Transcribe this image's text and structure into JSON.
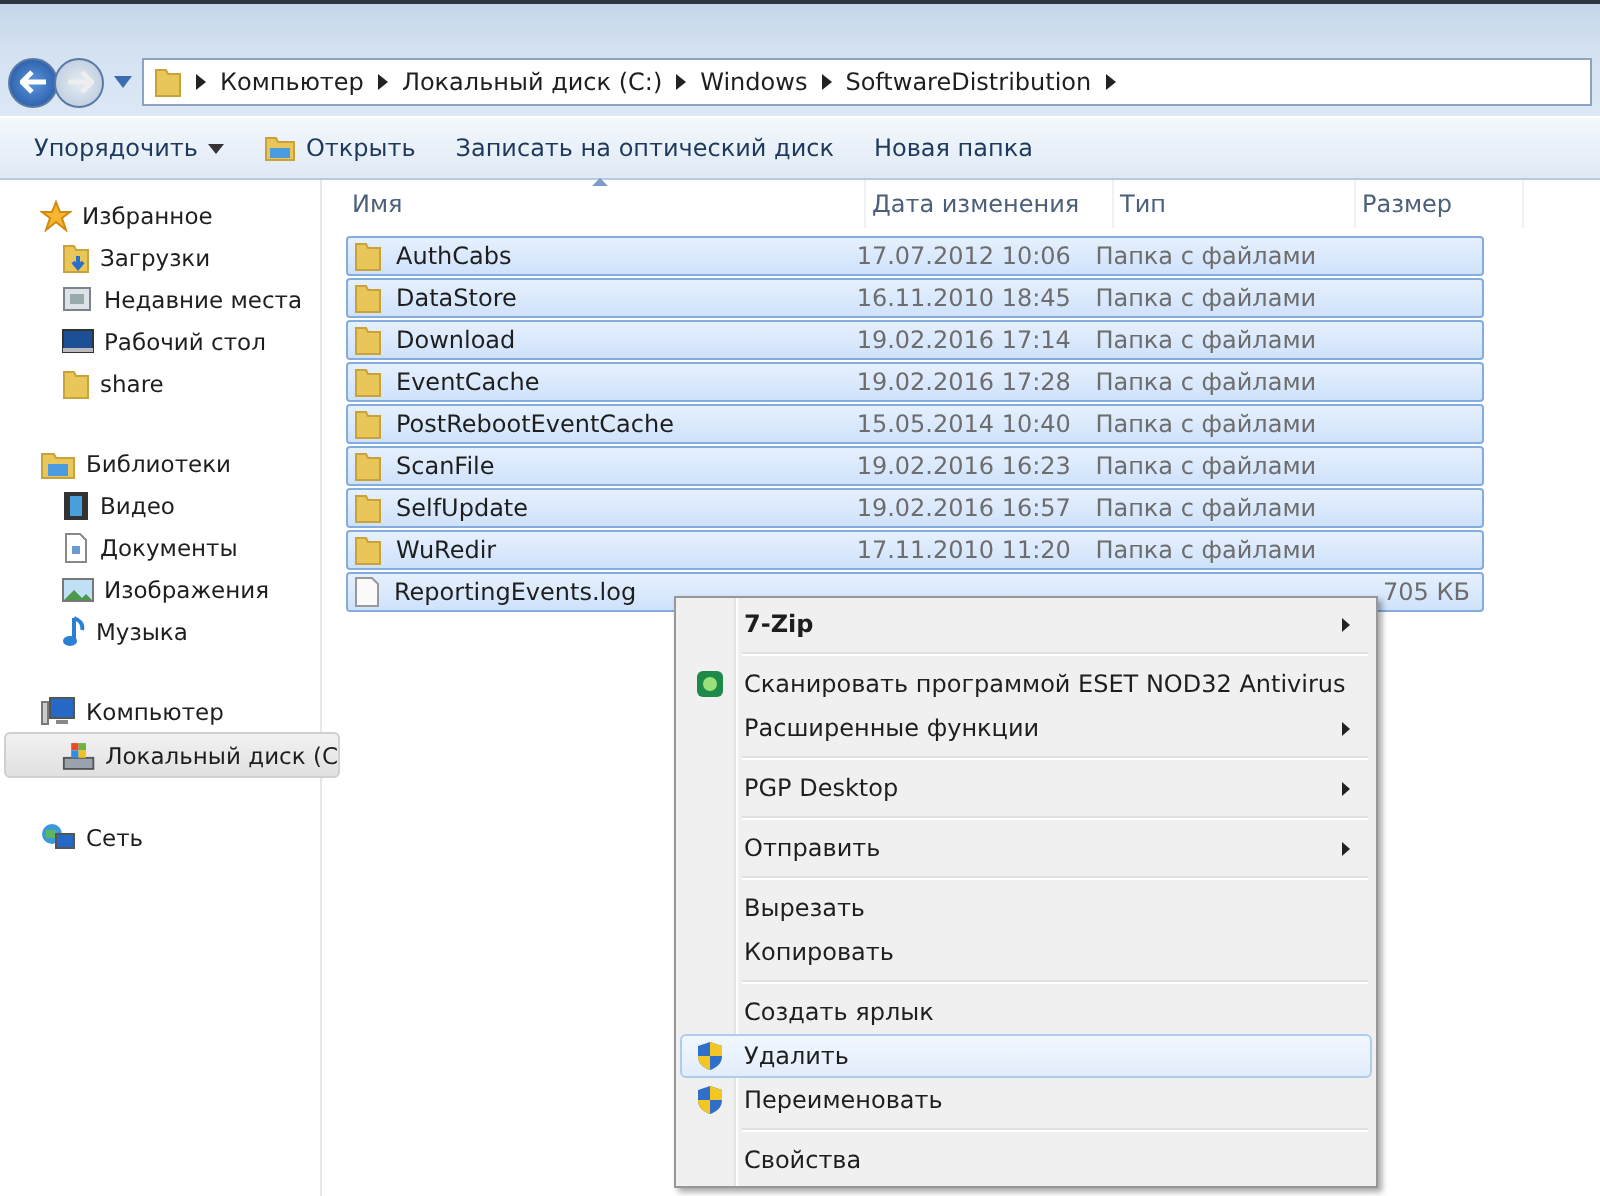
{
  "address_bar": {
    "crumbs": [
      "Компьютер",
      "Локальный диск (C:)",
      "Windows",
      "SoftwareDistribution"
    ]
  },
  "toolbar": {
    "items": [
      {
        "label": "Упорядочить",
        "kind": "dropdown"
      },
      {
        "label": "Открыть",
        "kind": "open"
      },
      {
        "label": "Записать на оптический диск",
        "kind": "plain"
      },
      {
        "label": "Новая папка",
        "kind": "plain"
      }
    ]
  },
  "sidebar": {
    "groups": [
      {
        "label": "Избранное",
        "kind": "star",
        "selected": false,
        "children": [
          {
            "label": "Загрузки",
            "kind": "download",
            "selected": false
          },
          {
            "label": "Недавние места",
            "kind": "recent",
            "selected": false
          },
          {
            "label": "Рабочий стол",
            "kind": "desktop",
            "selected": false
          },
          {
            "label": "share",
            "kind": "folder",
            "selected": false
          }
        ]
      },
      {
        "label": "Библиотеки",
        "kind": "library",
        "selected": false,
        "children": [
          {
            "label": "Видео",
            "kind": "video",
            "selected": false
          },
          {
            "label": "Документы",
            "kind": "documents",
            "selected": false
          },
          {
            "label": "Изображения",
            "kind": "pictures",
            "selected": false
          },
          {
            "label": "Музыка",
            "kind": "music",
            "selected": false
          }
        ]
      },
      {
        "label": "Компьютер",
        "kind": "computer",
        "selected": false,
        "children": [
          {
            "label": "Локальный диск (C",
            "kind": "drive",
            "selected": true
          }
        ]
      },
      {
        "label": "Сеть",
        "kind": "network",
        "selected": false
      }
    ]
  },
  "table": {
    "columns": [
      "Имя",
      "Дата изменения",
      "Тип",
      "Размер"
    ],
    "rows": [
      {
        "kind": "folder",
        "name": "AuthCabs",
        "date": "17.07.2012 10:06",
        "type": "Папка с файлами",
        "selected": true
      },
      {
        "kind": "folder",
        "name": "DataStore",
        "date": "16.11.2010 18:45",
        "type": "Папка с файлами",
        "selected": true
      },
      {
        "kind": "folder",
        "name": "Download",
        "date": "19.02.2016 17:14",
        "type": "Папка с файлами",
        "selected": true
      },
      {
        "kind": "folder",
        "name": "EventCache",
        "date": "19.02.2016 17:28",
        "type": "Папка с файлами",
        "selected": true
      },
      {
        "kind": "folder",
        "name": "PostRebootEventCache",
        "date": "15.05.2014 10:40",
        "type": "Папка с файлами",
        "selected": true
      },
      {
        "kind": "folder",
        "name": "ScanFile",
        "date": "19.02.2016 16:23",
        "type": "Папка с файлами",
        "selected": true
      },
      {
        "kind": "folder",
        "name": "SelfUpdate",
        "date": "19.02.2016 16:57",
        "type": "Папка с файлами",
        "selected": true
      },
      {
        "kind": "folder",
        "name": "WuRedir",
        "date": "17.11.2010 11:20",
        "type": "Папка с файлами",
        "selected": true
      },
      {
        "kind": "file",
        "name": "ReportingEvents.log",
        "size": "705 КБ",
        "selected": true
      }
    ]
  },
  "context_menu": {
    "groups": [
      [
        {
          "label": "7-Zip",
          "kind": "bold",
          "submenu": true,
          "selected": false
        }
      ],
      [
        {
          "label": "Сканировать программой ESET NOD32 Antivirus",
          "kind": "scan",
          "submenu": false,
          "selected": false
        },
        {
          "label": "Расширенные функции",
          "kind": "plain",
          "submenu": true,
          "selected": false
        }
      ],
      [
        {
          "label": "PGP Desktop",
          "kind": "plain",
          "submenu": true,
          "selected": false
        }
      ],
      [
        {
          "label": "Отправить",
          "kind": "plain",
          "submenu": true,
          "selected": false
        }
      ],
      [
        {
          "label": "Вырезать",
          "kind": "plain",
          "submenu": false,
          "selected": false
        },
        {
          "label": "Копировать",
          "kind": "plain",
          "submenu": false,
          "selected": false
        }
      ],
      [
        {
          "label": "Создать ярлык",
          "kind": "plain",
          "submenu": false,
          "selected": false
        },
        {
          "label": "Удалить",
          "kind": "elevated",
          "submenu": false,
          "selected": true
        },
        {
          "label": "Переименовать",
          "kind": "elevated",
          "submenu": false,
          "selected": false
        }
      ],
      [
        {
          "label": "Свойства",
          "kind": "plain",
          "submenu": false,
          "selected": false
        }
      ]
    ]
  }
}
